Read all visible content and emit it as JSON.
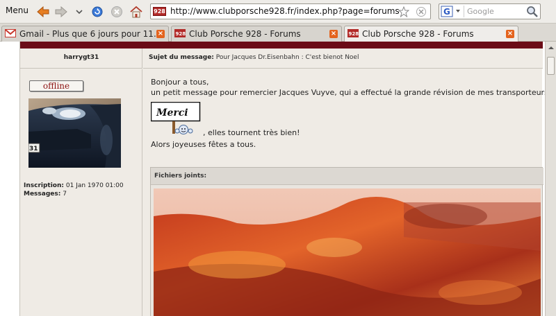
{
  "browser": {
    "menu_label": "Menu",
    "url": "http://www.clubporsche928.fr/index.php?page=forums",
    "site_badge": "928",
    "search_placeholder": "Google",
    "search_engine_letter": "G"
  },
  "tabs": [
    {
      "label": "Gmail - Plus que 6 jours pour 11...",
      "icon": "gmail-icon",
      "active": false
    },
    {
      "label": "Club Porsche 928 - Forums",
      "icon": "porsche-928-icon",
      "active": false
    },
    {
      "label": "Club Porsche 928 - Forums",
      "icon": "porsche-928-icon",
      "active": true
    }
  ],
  "post": {
    "author": "harrygt31",
    "subject_label": "Sujet du message:",
    "subject": "Pour Jacques Dr.Eisenbahn : C'est bienot Noel",
    "status": "offline",
    "inscription_label": "Inscription:",
    "inscription_value": "01 Jan 1970 01:00",
    "messages_label": "Messages:",
    "messages_value": "7",
    "body_line1": "Bonjour a tous,",
    "body_line2": "un petit message pour remercier Jacques Vuyve, qui a effectué la grande révision de mes transporteurs",
    "merci_text": "Merci",
    "body_line3": ", elles tournent très bien!",
    "body_line4": "Alors joyeuses fêtes a tous.",
    "attachments_label": "Fichiers joints:"
  },
  "colors": {
    "accent": "#6b0c17",
    "status_text": "#8c1313",
    "panel": "#efebe5"
  }
}
